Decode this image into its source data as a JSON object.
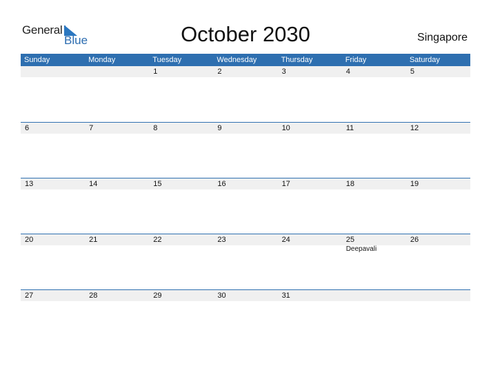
{
  "logo": {
    "line1": "General",
    "line2": "Blue"
  },
  "title": "October 2030",
  "country": "Singapore",
  "weekdays": [
    "Sunday",
    "Monday",
    "Tuesday",
    "Wednesday",
    "Thursday",
    "Friday",
    "Saturday"
  ],
  "weeks": [
    {
      "dates": [
        "",
        "",
        "1",
        "2",
        "3",
        "4",
        "5"
      ],
      "notes": [
        "",
        "",
        "",
        "",
        "",
        "",
        ""
      ]
    },
    {
      "dates": [
        "6",
        "7",
        "8",
        "9",
        "10",
        "11",
        "12"
      ],
      "notes": [
        "",
        "",
        "",
        "",
        "",
        "",
        ""
      ]
    },
    {
      "dates": [
        "13",
        "14",
        "15",
        "16",
        "17",
        "18",
        "19"
      ],
      "notes": [
        "",
        "",
        "",
        "",
        "",
        "",
        ""
      ]
    },
    {
      "dates": [
        "20",
        "21",
        "22",
        "23",
        "24",
        "25",
        "26"
      ],
      "notes": [
        "",
        "",
        "",
        "",
        "",
        "Deepavali",
        ""
      ]
    },
    {
      "dates": [
        "27",
        "28",
        "29",
        "30",
        "31",
        "",
        ""
      ],
      "notes": [
        "",
        "",
        "",
        "",
        "",
        "",
        ""
      ]
    }
  ]
}
